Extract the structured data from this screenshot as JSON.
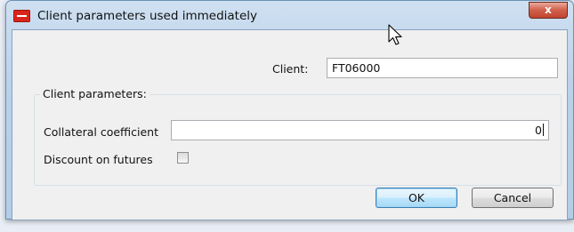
{
  "window": {
    "title": "Client parameters used immediately",
    "close_label": "x"
  },
  "client": {
    "label": "Client:",
    "value": "FT06000"
  },
  "client_parameters": {
    "legend": "Client parameters:",
    "collateral_label": "Collateral coefficient",
    "collateral_value": "0",
    "discount_label": "Discount on futures",
    "discount_checked": false
  },
  "buttons": {
    "ok": "OK",
    "cancel": "Cancel"
  },
  "colors": {
    "accent": "#3c7fb1",
    "app_icon": "#d9261c"
  },
  "icons": {
    "app": "app-logo-icon",
    "close": "close-icon",
    "cursor": "mouse-cursor-icon"
  }
}
